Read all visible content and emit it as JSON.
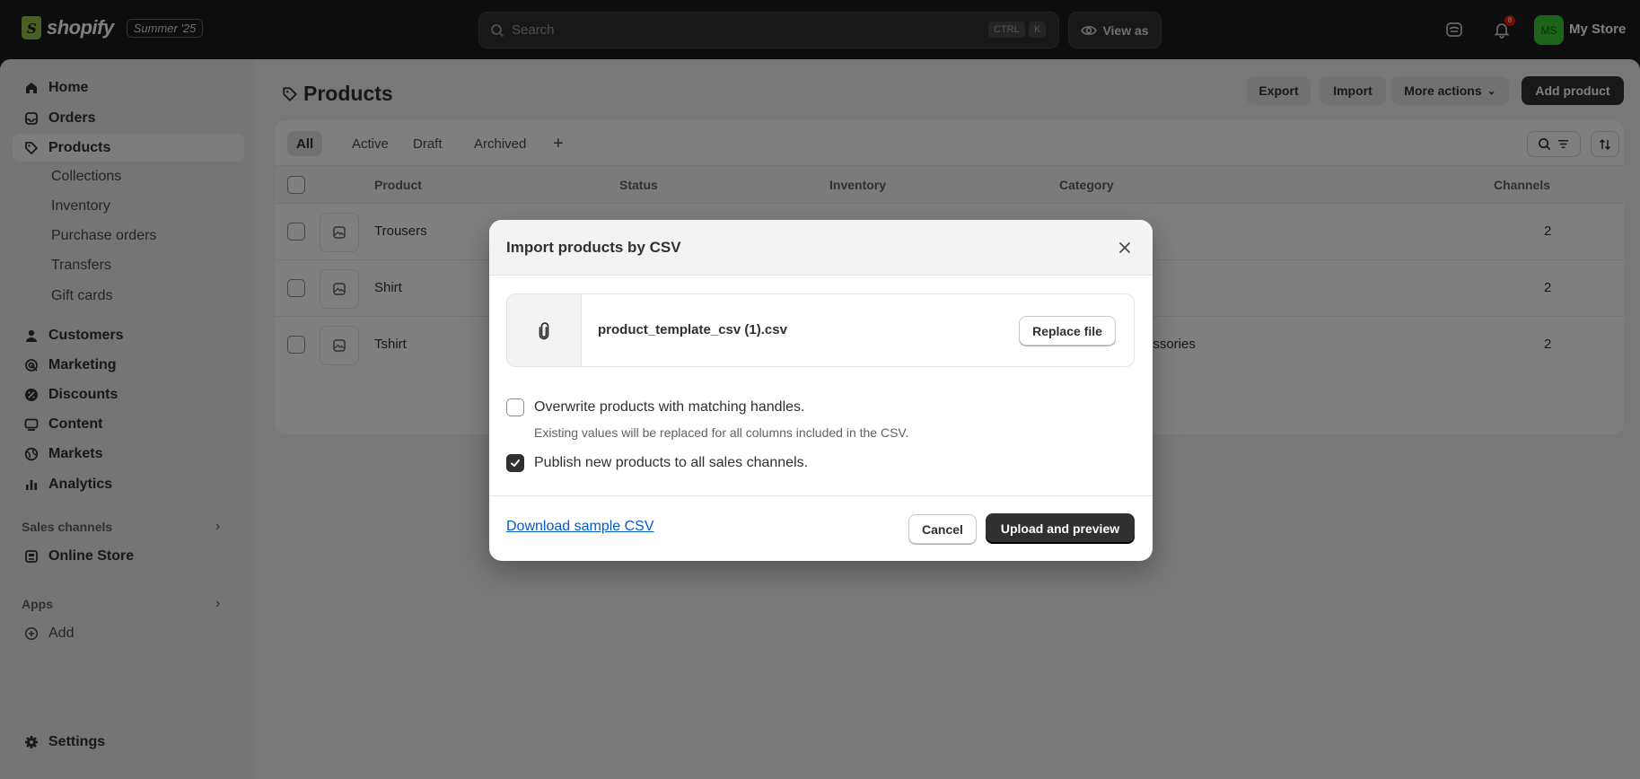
{
  "topbar": {
    "brand": "shopify",
    "season_badge": "Summer '25",
    "search_placeholder": "Search",
    "kbd_ctrl": "CTRL",
    "kbd_k": "K",
    "view_as": "View as",
    "notification_count": "8",
    "avatar_initials": "MS",
    "store_name": "My Store"
  },
  "sidebar": {
    "home": "Home",
    "orders": "Orders",
    "products": "Products",
    "collections": "Collections",
    "inventory": "Inventory",
    "purchase_orders": "Purchase orders",
    "transfers": "Transfers",
    "gift_cards": "Gift cards",
    "customers": "Customers",
    "marketing": "Marketing",
    "discounts": "Discounts",
    "content": "Content",
    "markets": "Markets",
    "analytics": "Analytics",
    "sales_channels": "Sales channels",
    "online_store": "Online Store",
    "apps": "Apps",
    "add": "Add",
    "settings": "Settings"
  },
  "page": {
    "title": "Products",
    "export": "Export",
    "import": "Import",
    "more_actions": "More actions",
    "add_product": "Add product"
  },
  "tabs": [
    "All",
    "Active",
    "Draft",
    "Archived"
  ],
  "table": {
    "headers": {
      "product": "Product",
      "status": "Status",
      "inventory": "Inventory",
      "category": "Category",
      "channels": "Channels"
    },
    "rows": [
      {
        "product": "Trousers",
        "category": "",
        "channels": "2"
      },
      {
        "product": "Shirt",
        "category": "",
        "channels": "2"
      },
      {
        "product": "Tshirt",
        "category": "essories",
        "channels": "2"
      }
    ]
  },
  "modal": {
    "title": "Import products by CSV",
    "file_name": "product_template_csv (1).csv",
    "replace_file": "Replace file",
    "overwrite_label": "Overwrite products with matching handles.",
    "overwrite_checked": false,
    "overwrite_help": "Existing values will be replaced for all columns included in the CSV.",
    "publish_label": "Publish new products to all sales channels.",
    "publish_checked": true,
    "download_sample": "Download sample CSV",
    "cancel": "Cancel",
    "upload": "Upload and preview"
  },
  "colors": {
    "topbar_bg": "#1a1a1a",
    "primary_button": "#303030",
    "link": "#005bd3",
    "avatar_bg": "#36c933"
  }
}
